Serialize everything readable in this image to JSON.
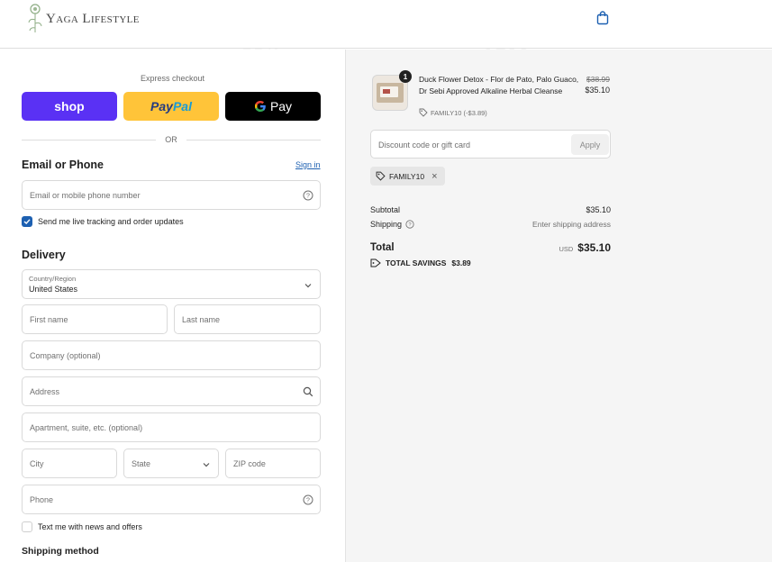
{
  "header": {
    "brand": "Yaga Lifestyle",
    "cart_icon": "shopping-bag-icon"
  },
  "express": {
    "label": "Express checkout",
    "shop_label": "shop",
    "paypal_part1": "Pay",
    "paypal_part2": "Pal",
    "gpay_label": "Pay",
    "or_label": "OR"
  },
  "contact": {
    "heading": "Email or Phone",
    "signin_label": "Sign in",
    "input_placeholder": "Email or mobile phone number",
    "tracking_label": "Send me live tracking and order updates",
    "tracking_checked": true
  },
  "delivery": {
    "heading": "Delivery",
    "country_label": "Country/Region",
    "country_value": "United States",
    "first_name": "First name",
    "last_name": "Last name",
    "company": "Company (optional)",
    "address": "Address",
    "apartment": "Apartment, suite, etc. (optional)",
    "city": "City",
    "state": "State",
    "zip": "ZIP code",
    "phone": "Phone",
    "news_label": "Text me with news and offers",
    "news_checked": false
  },
  "shipping_method": {
    "heading": "Shipping method"
  },
  "order": {
    "item": {
      "quantity": "1",
      "name": "Duck Flower Detox - Flor de Pato, Palo Guaco, Dr Sebi Approved Alkaline Herbal Cleanse",
      "discount_note": "FAMILY10 (-$3.89)",
      "original_price": "$38.99",
      "price": "$35.10"
    },
    "discount_placeholder": "Discount code or gift card",
    "apply_label": "Apply",
    "applied_code": "FAMILY10",
    "subtotal_label": "Subtotal",
    "subtotal_value": "$35.10",
    "shipping_label": "Shipping",
    "shipping_value": "Enter shipping address",
    "total_label": "Total",
    "total_currency": "USD",
    "total_value": "$35.10",
    "savings_label": "TOTAL SAVINGS",
    "savings_value": "$3.89"
  },
  "colors": {
    "accent": "#1d60b1",
    "shop": "#5a31f4",
    "paypal": "#ffc439",
    "gpay": "#000000",
    "sidebar": "#f5f5f5"
  }
}
